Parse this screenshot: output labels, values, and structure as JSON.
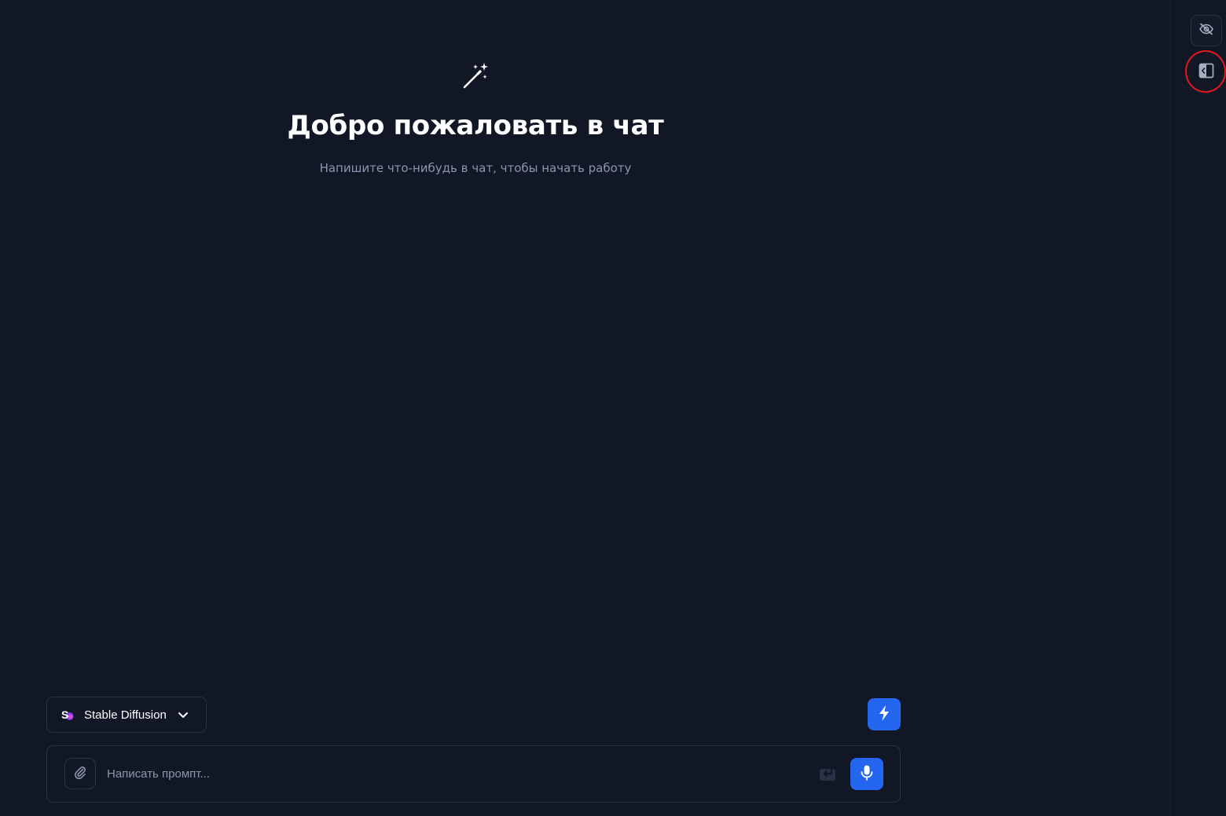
{
  "welcome": {
    "title": "Добро пожаловать в чат",
    "subtitle": "Напишите что-нибудь в чат, чтобы начать работу",
    "icon": "magic-wand-icon"
  },
  "model_selector": {
    "selected": "Stable Diffusion",
    "logo_text": "S",
    "icons": [
      "stable-diffusion-logo",
      "chevron-down-icon"
    ]
  },
  "composer": {
    "placeholder": "Написать промпт...",
    "value": "",
    "icons": [
      "paperclip-icon",
      "enter-icon",
      "microphone-icon"
    ]
  },
  "toolbar": {
    "icons": [
      "lightning-icon"
    ]
  },
  "right_rail": {
    "icons": [
      "eye-off-icon",
      "sidebar-panel-icon"
    ],
    "highlighted": "sidebar-panel-icon"
  },
  "colors": {
    "background": "#121726",
    "accent": "#2466f0",
    "border": "#2b3145",
    "muted_text": "#8d95ad",
    "highlight": "#e0191f"
  }
}
